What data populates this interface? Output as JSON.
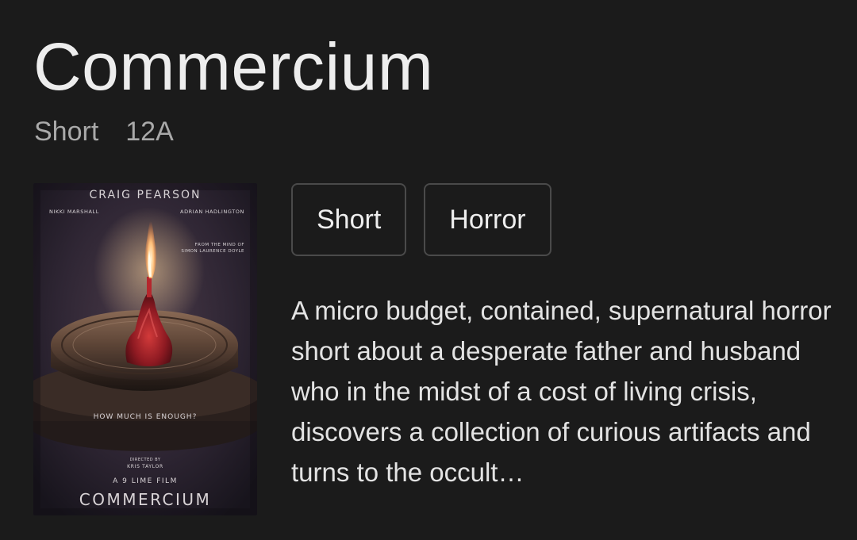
{
  "title": "Commercium",
  "meta": {
    "type": "Short",
    "rating": "12A"
  },
  "poster": {
    "lead_actor": "CRAIG PEARSON",
    "actor_left": "NIKKI MARSHALL",
    "actor_right": "ADRIAN HADLINGTON",
    "credit_line1": "FROM THE MIND OF",
    "credit_line2": "SIMON LAURENCE DOYLE",
    "tagline": "HOW MUCH IS ENOUGH?",
    "directed_by": "DIRECTED BY",
    "director": "KRIS TAYLOR",
    "studio": "A 9 LIME FILM",
    "film_title": "COMMERCIUM"
  },
  "genres": [
    "Short",
    "Horror"
  ],
  "description": "A micro budget, contained, supernatural horror short about a desperate father and husband who in the midst of a cost of living crisis, discovers a collection of curious artifacts and turns to the occult…"
}
